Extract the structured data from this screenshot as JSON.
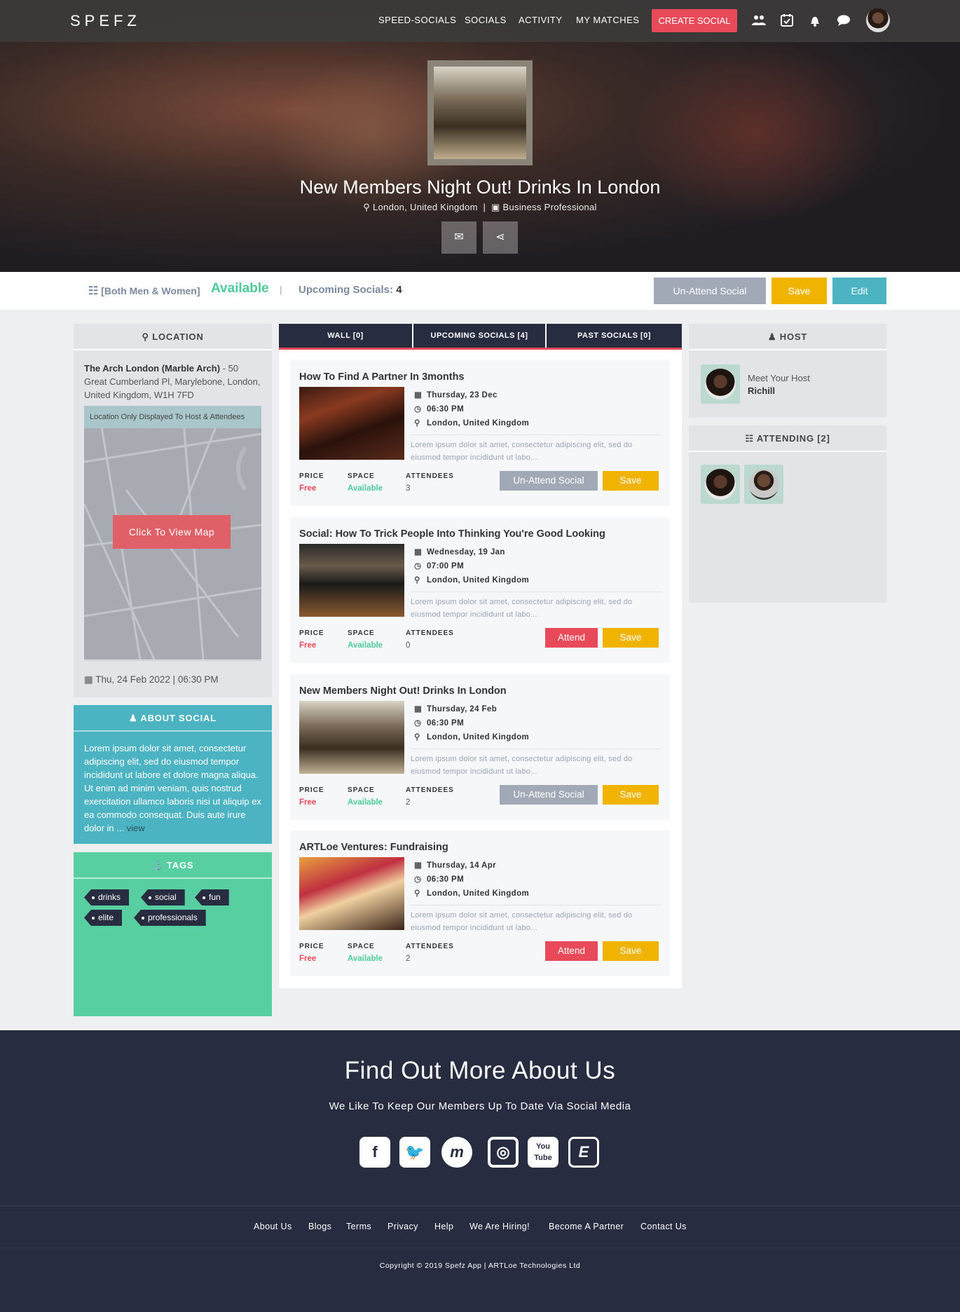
{
  "brand": {
    "logo": "SPEFZ",
    "accent": "#e84a5a",
    "navy": "#272c40",
    "teal": "#4bb3c1",
    "green": "#58cfa1",
    "yellow": "#f0b400"
  },
  "nav": {
    "links": [
      "SPEED-SOCIALS",
      "SOCIALS",
      "ACTIVITY",
      "MY MATCHES"
    ],
    "create_label": "CREATE SOCIAL",
    "icons": [
      "users-icon",
      "calendar-check-icon",
      "bell-icon",
      "chat-icon"
    ]
  },
  "hero": {
    "title": "New Members Night Out! Drinks In London",
    "location": "London, United Kingdom",
    "category": "Business Professional",
    "buttons": [
      "envelope-icon",
      "share-icon"
    ]
  },
  "status": {
    "group": "[Both Men & Women]",
    "availability": "Available",
    "separator": "|",
    "upcoming_label": "Upcoming Socials:",
    "upcoming_count": "4",
    "unattend_label": "Un-Attend Social",
    "save_label": "Save",
    "edit_label": "Edit"
  },
  "location": {
    "heading": "LOCATION",
    "venue": "The Arch London (Marble Arch)",
    "address": " - 50 Great Cumberland Pl, Marylebone, London, United Kingdom, W1H 7FD",
    "notice": "Location Only Displayed To Host & Attendees",
    "map_button": "Click To View Map",
    "datetime": "Thu, 24 Feb 2022 | 06:30 PM"
  },
  "about": {
    "heading": "ABOUT SOCIAL",
    "text": "Lorem ipsum dolor sit amet, consectetur adipiscing elit, sed do eiusmod tempor incididunt ut labore et dolore magna aliqua. Ut enim ad minim veniam, quis nostrud exercitation ullamco laboris nisi ut aliquip ex ea commodo consequat. Duis aute irure dolor in ...",
    "view_link": "view"
  },
  "tags": {
    "heading": "TAGS",
    "items": [
      "drinks",
      "social",
      "fun",
      "elite",
      "professionals"
    ]
  },
  "tabs": [
    "WALL [0]",
    "UPCOMING SOCIALS [4]",
    "PAST SOCIALS [0]"
  ],
  "card_labels": {
    "price": "PRICE",
    "space": "SPACE",
    "attendees": "ATTENDEES"
  },
  "socials": [
    {
      "title": "How To Find A Partner In 3months",
      "date": "Thursday, 23 Dec",
      "time": "06:30 PM",
      "location": "London, United Kingdom",
      "description": "Lorem ipsum dolor sit amet, consectetur adipiscing elit, sed do eiusmod tempor incididunt ut labo...",
      "price": "Free",
      "space": "Available",
      "attendees": "3",
      "action": "Un-Attend Social",
      "save": "Save"
    },
    {
      "title": "Social: How To Trick People Into Thinking You're Good Looking",
      "date": "Wednesday, 19 Jan",
      "time": "07:00 PM",
      "location": "London, United Kingdom",
      "description": "Lorem ipsum dolor sit amet, consectetur adipiscing elit, sed do eiusmod tempor incididunt ut labo...",
      "price": "Free",
      "space": "Available",
      "attendees": "0",
      "action": "Attend",
      "save": "Save"
    },
    {
      "title": "New Members Night Out! Drinks In London",
      "date": "Thursday, 24 Feb",
      "time": "06:30 PM",
      "location": "London, United Kingdom",
      "description": "Lorem ipsum dolor sit amet, consectetur adipiscing elit, sed do eiusmod tempor incididunt ut labo...",
      "price": "Free",
      "space": "Available",
      "attendees": "2",
      "action": "Un-Attend Social",
      "save": "Save"
    },
    {
      "title": "ARTLoe Ventures: Fundraising",
      "date": "Thursday, 14 Apr",
      "time": "06:30 PM",
      "location": "London, United Kingdom",
      "description": "Lorem ipsum dolor sit amet, consectetur adipiscing elit, sed do eiusmod tempor incididunt ut labo...",
      "price": "Free",
      "space": "Available",
      "attendees": "2",
      "action": "Attend",
      "save": "Save"
    }
  ],
  "host": {
    "heading": "HOST",
    "meet_label": "Meet Your Host",
    "name": "Richill"
  },
  "attending": {
    "heading": "ATTENDING [2]"
  },
  "footer": {
    "title": "Find Out More About Us",
    "subtitle": "We Like To Keep Our Members Up To Date Via Social Media",
    "social_icons": [
      "facebook-icon",
      "twitter-icon",
      "meetup-icon",
      "instagram-icon",
      "youtube-icon",
      "eventbrite-icon"
    ],
    "links": [
      "About Us",
      "Blogs",
      "Terms",
      "Privacy",
      "Help",
      "We Are Hiring!",
      "Become A Partner",
      "Contact Us"
    ],
    "copyright": "Copyright © 2019 Spefz App | ARTLoe Technologies Ltd"
  }
}
